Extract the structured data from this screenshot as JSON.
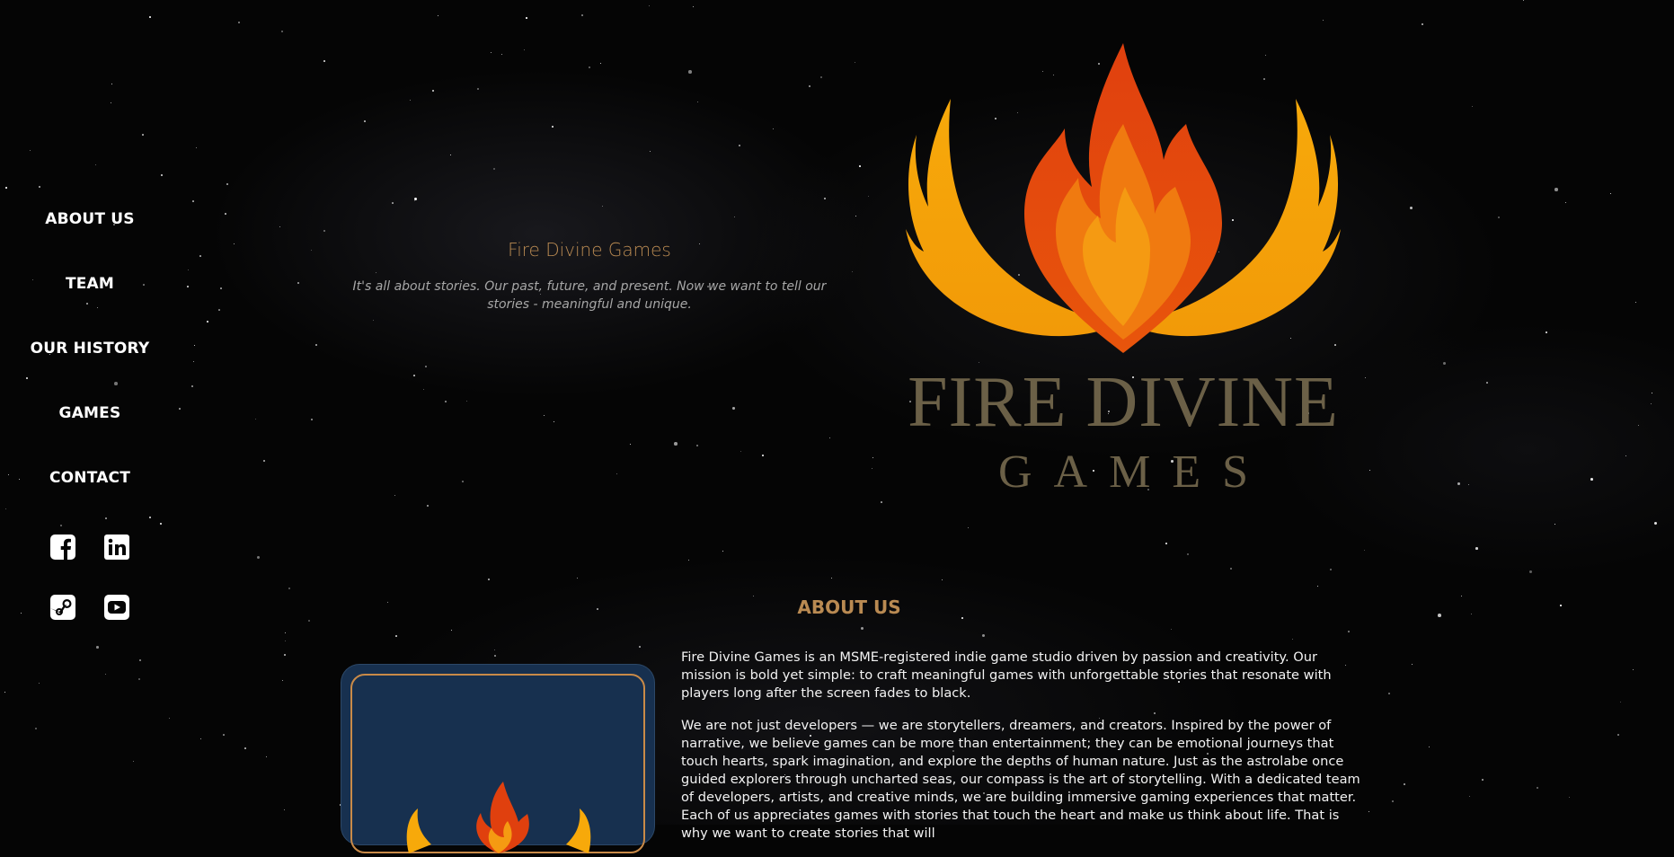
{
  "nav": {
    "items": [
      {
        "label": "ABOUT US"
      },
      {
        "label": "TEAM"
      },
      {
        "label": "OUR HISTORY"
      },
      {
        "label": "GAMES"
      },
      {
        "label": "CONTACT"
      }
    ],
    "social_icons": [
      "facebook-icon",
      "linkedin-icon",
      "steam-icon",
      "youtube-icon"
    ]
  },
  "hero": {
    "title": "Fire Divine Games",
    "tagline": "It's all about stories. Our past, future, and present. Now we want to tell our stories - meaningful and unique."
  },
  "logo": {
    "word1": "FIRE DIVINE",
    "word2": "GAMES"
  },
  "about": {
    "heading": "ABOUT US",
    "paragraphs": [
      "Fire Divine Games is an MSME-registered indie game studio driven by passion and creativity. Our mission is bold yet simple: to craft meaningful games with unforgettable stories that resonate with players long after the screen fades to black.",
      "We are not just developers — we are storytellers, dreamers, and creators. Inspired by the power of narrative, we believe games can be more than entertainment; they can be emotional journeys that touch hearts, spark imagination, and explore the depths of human nature. Just as the astrolabe once guided explorers through uncharted seas, our compass is the art of storytelling. With a dedicated team of developers, artists, and creative minds, we are building immersive gaming experiences that matter. Each of us appreciates games with stories that touch the heart and make us think about life. That is why we want to create stories that will"
    ]
  },
  "colors": {
    "accent": "#b98a52",
    "background": "#050505",
    "logo_text": "#6b6047",
    "card_bg": "#17304f",
    "card_border": "#c98a48"
  }
}
